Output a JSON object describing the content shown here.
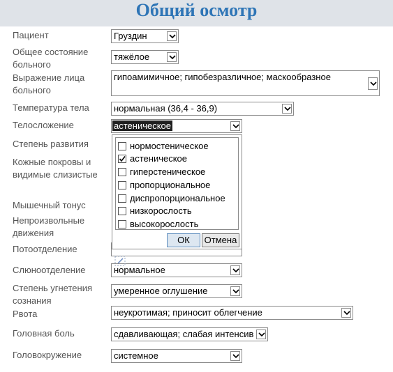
{
  "title": "Общий осмотр",
  "fields": [
    {
      "label": "Пациент",
      "value": "Груздин"
    },
    {
      "label": "Общее состояние больного",
      "value": "тяжёлое"
    },
    {
      "label": "Выражение лица больного",
      "value": "гипоамимичное; гипобезразличное; маскообразное"
    },
    {
      "label": "Температура тела",
      "value": "нормальная (36,4 - 36,9)"
    },
    {
      "label": "Телосложение",
      "value": "астеническое"
    },
    {
      "label": "Степень развития",
      "value": ""
    },
    {
      "label": "Кожные покровы и видимые слизистые",
      "value": ""
    },
    {
      "label": "Мышечный тонус",
      "value": ""
    },
    {
      "label": "Непроизвольные движения",
      "value": ""
    },
    {
      "label": "Потоотделение",
      "value": ""
    },
    {
      "label": "Слюноотделение",
      "value": "нормальное"
    },
    {
      "label": "Степень угнетения сознания",
      "value": "умеренное оглушение"
    },
    {
      "label": "Рвота",
      "value": "неукротимая; приносит облегчение"
    },
    {
      "label": "Головная боль",
      "value": "сдавливающая; слабая интенсив"
    },
    {
      "label": "Головокружение",
      "value": "системное"
    }
  ],
  "dropdown": {
    "options": [
      {
        "label": "нормостеническое",
        "checked": false
      },
      {
        "label": "астеническое",
        "checked": true
      },
      {
        "label": "гиперстеническое",
        "checked": false
      },
      {
        "label": "пропорциональное",
        "checked": false
      },
      {
        "label": "диспропорциональное",
        "checked": false
      },
      {
        "label": "низкорослость",
        "checked": false
      },
      {
        "label": "высокорослость",
        "checked": false
      }
    ],
    "ok_label": "ОК",
    "cancel_label": "Отмена"
  },
  "colors": {
    "title": "#2e75b6",
    "header_bg": "#dfe3e8"
  }
}
